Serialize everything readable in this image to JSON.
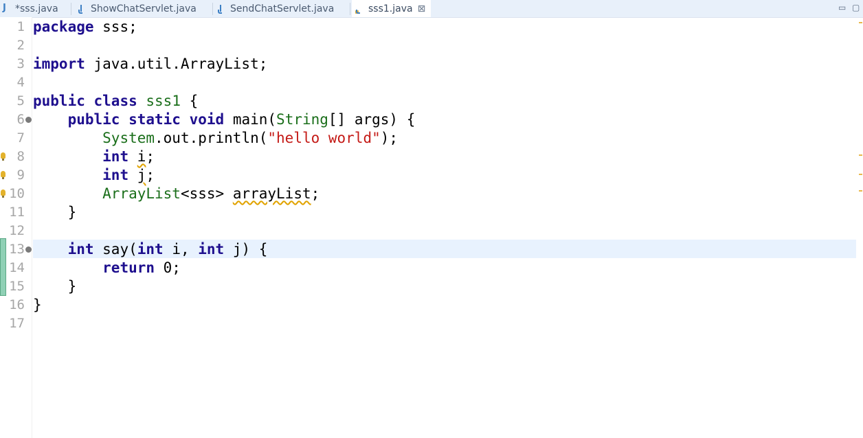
{
  "tabs": [
    {
      "label": "*sss.java",
      "icon": "java-file-icon"
    },
    {
      "label": "ShowChatServlet.java",
      "icon": "java-file-icon"
    },
    {
      "label": "SendChatServlet.java",
      "icon": "java-file-icon"
    },
    {
      "label": "sss1.java",
      "icon": "java-file-warning-icon",
      "close_glyph": "⊠"
    }
  ],
  "window_controls": {
    "minimize": "▭",
    "maximize": "▢"
  },
  "editor": {
    "line_numbers": [
      "1",
      "2",
      "3",
      "4",
      "5",
      "6",
      "7",
      "8",
      "9",
      "10",
      "11",
      "12",
      "13",
      "14",
      "15",
      "16",
      "17"
    ],
    "lines": {
      "l1": {
        "kw": "package",
        "rest": " sss;"
      },
      "l3": {
        "kw": "import",
        "rest": " java.util.ArrayList;"
      },
      "l5": {
        "kw1": "public",
        "kw2": "class",
        "name": "sss1",
        "rest": " {"
      },
      "l6": {
        "indent": "    ",
        "kw1": "public",
        "kw2": "static",
        "kw3": "void",
        "name": " main(",
        "type": "String",
        "rest": "[] args) {"
      },
      "l7": {
        "indent": "        ",
        "type": "System",
        "mid": ".out.println(",
        "str": "\"hello world\"",
        "rest": ");"
      },
      "l8": {
        "indent": "        ",
        "kw": "int",
        "var": "i",
        "rest": ";"
      },
      "l9": {
        "indent": "        ",
        "kw": "int",
        "var": "j",
        "rest": ";"
      },
      "l10": {
        "indent": "        ",
        "type": "ArrayList",
        "mid": "<sss> ",
        "var": "arrayList",
        "rest": ";"
      },
      "l11": {
        "indent": "    ",
        "rest": "}"
      },
      "l13": {
        "indent": "    ",
        "kw1": "int",
        "name": " say(",
        "kw2": "int",
        "mid": " i, ",
        "kw3": "int",
        "rest": " j) {"
      },
      "l14": {
        "indent": "        ",
        "kw": "return",
        "rest": " 0;"
      },
      "l15": {
        "indent": "    ",
        "rest": "}"
      },
      "l16": {
        "rest": "}"
      }
    }
  },
  "colors": {
    "keyword": "#1e0f8e",
    "type": "#1a6e1a",
    "string": "#c41a16",
    "current_line": "#e8f2fe",
    "warning": "#e3b22b"
  }
}
